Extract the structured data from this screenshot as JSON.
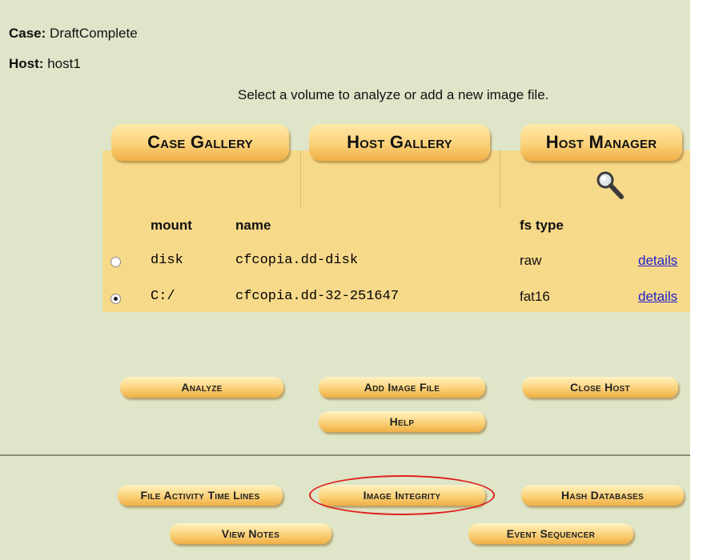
{
  "case": {
    "label": "Case:",
    "value": "DraftComplete"
  },
  "host": {
    "label": "Host:",
    "value": "host1"
  },
  "prompt": "Select a volume to analyze or add a new image file.",
  "gallery_tabs": {
    "case_gallery": "Case Gallery",
    "host_gallery": "Host Gallery",
    "host_manager": "Host Manager"
  },
  "table": {
    "headers": {
      "mount": "mount",
      "name": "name",
      "fs_type": "fs type"
    },
    "rows": [
      {
        "selected": false,
        "mount": "disk",
        "name": "cfcopia.dd-disk",
        "fs_type": "raw",
        "link": "details"
      },
      {
        "selected": true,
        "mount": "C:/",
        "name": "cfcopia.dd-32-251647",
        "fs_type": "fat16",
        "link": "details"
      }
    ]
  },
  "actions": {
    "analyze": "Analyze",
    "add_image_file": "Add Image File",
    "close_host": "Close Host",
    "help": "Help"
  },
  "tools": {
    "file_activity": "File Activity Time Lines",
    "image_integrity": "Image Integrity",
    "hash_databases": "Hash Databases",
    "view_notes": "View Notes",
    "event_sequencer": "Event Sequencer"
  },
  "colors": {
    "background": "#dee5c8",
    "panel": "#f7d98a",
    "button": "#fbd27a",
    "link": "#2222cc",
    "highlight": "#e0201c"
  },
  "icons": {
    "host_manager": "magnifier-icon"
  }
}
